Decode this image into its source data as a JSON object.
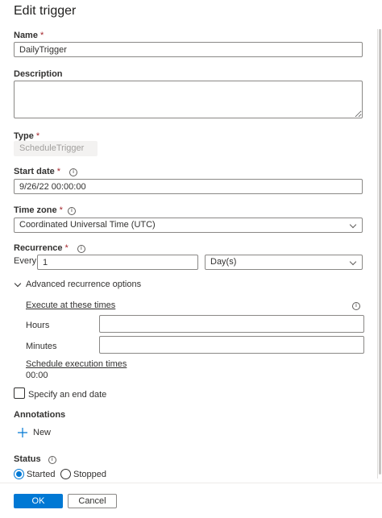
{
  "panel": {
    "title": "Edit trigger"
  },
  "name": {
    "label": "Name",
    "required": "*",
    "value": "DailyTrigger"
  },
  "description": {
    "label": "Description",
    "value": ""
  },
  "type": {
    "label": "Type",
    "required": "*",
    "value": "ScheduleTrigger"
  },
  "start_date": {
    "label": "Start date",
    "required": "*",
    "value": "9/26/22 00:00:00"
  },
  "time_zone": {
    "label": "Time zone",
    "required": "*",
    "value": "Coordinated Universal Time (UTC)"
  },
  "recurrence": {
    "label": "Recurrence",
    "required": "*",
    "every_label": "Every",
    "interval_value": "1",
    "unit_value": "Day(s)"
  },
  "advanced": {
    "toggle_label": "Advanced recurrence options",
    "execute_link": "Execute at these times",
    "hours_label": "Hours",
    "hours_value": "",
    "minutes_label": "Minutes",
    "minutes_value": "",
    "schedule_link": "Schedule execution times",
    "schedule_value": "00:00"
  },
  "end_date": {
    "label": "Specify an end date",
    "checked": false
  },
  "annotations": {
    "label": "Annotations",
    "new_label": "New"
  },
  "status": {
    "label": "Status",
    "options": [
      "Started",
      "Stopped"
    ],
    "selected": "Started"
  },
  "footer": {
    "ok_label": "OK",
    "cancel_label": "Cancel"
  },
  "info_icon_glyph": "i",
  "colors": {
    "accent": "#0078d4",
    "required": "#a4262c"
  }
}
